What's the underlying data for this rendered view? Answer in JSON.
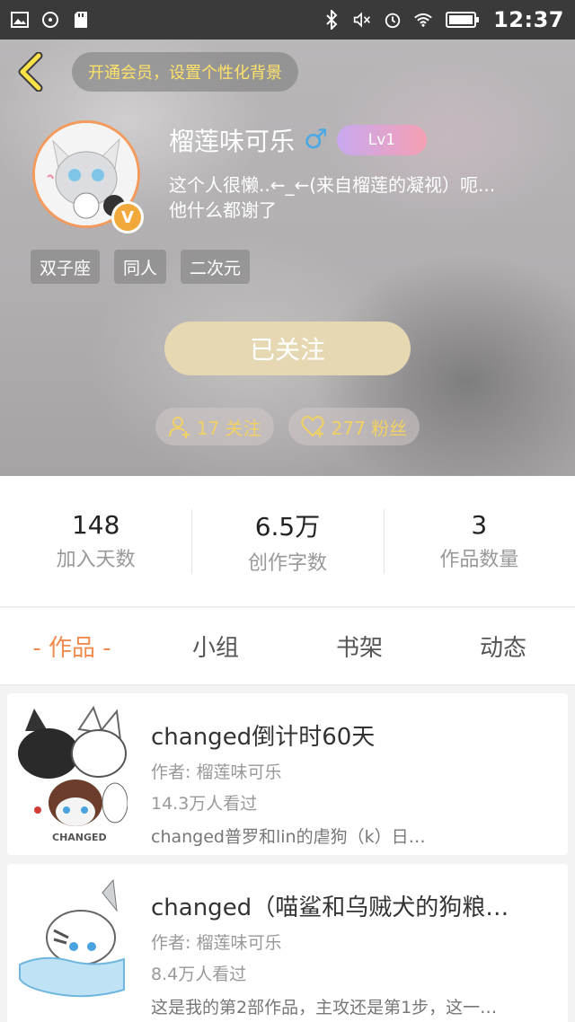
{
  "statusbar": {
    "time": "12:37"
  },
  "header": {
    "vip_banner": "开通会员，设置个性化背景",
    "username": "榴莲味可乐",
    "gender_symbol": "♂",
    "level": "Lv1",
    "verified_badge": "V",
    "bio_line1": "这个人很懒..←_←(来自榴莲的凝视）呃...",
    "bio_line2": "他什么都谢了",
    "tags": [
      "双子座",
      "同人",
      "二次元"
    ],
    "follow_button": "已关注",
    "following_count": "17 关注",
    "fans_count": "277 粉丝"
  },
  "stats": [
    {
      "value": "148",
      "label": "加入天数"
    },
    {
      "value": "6.5万",
      "label": "创作字数"
    },
    {
      "value": "3",
      "label": "作品数量"
    }
  ],
  "tabs": [
    "- 作品 -",
    "小组",
    "书架",
    "动态"
  ],
  "works": [
    {
      "title": "changed倒计时60天",
      "author": "作者: 榴莲味可乐",
      "views": "14.3万人看过",
      "desc": "changed普罗和lin的虐狗（k）日…",
      "thumb_text": "CHANGED"
    },
    {
      "title": "changed（喵鲨和乌贼犬的狗粮…",
      "author": "作者: 榴莲味可乐",
      "views": "8.4万人看过",
      "desc": "这是我的第2部作品，主攻还是第1步，这一…"
    }
  ],
  "colors": {
    "accent": "#f08a4e",
    "fans_text": "#f2d163",
    "follow_btn": "#e6d8b2",
    "vip_text": "#ffe268"
  }
}
